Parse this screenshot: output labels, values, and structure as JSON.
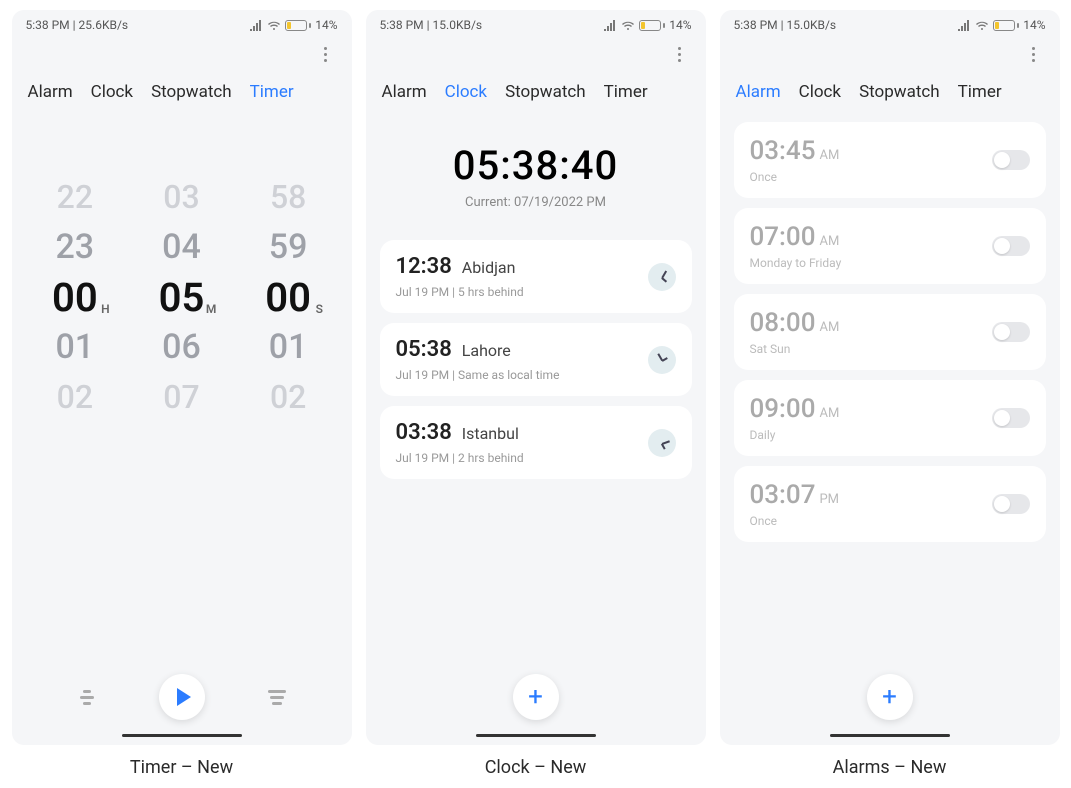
{
  "status": {
    "left1": "5:38 PM | 25.6KB/s",
    "left2": "5:38 PM | 15.0KB/s",
    "left3": "5:38 PM | 15.0KB/s",
    "battery": "14%"
  },
  "tabs": {
    "alarm": "Alarm",
    "clock": "Clock",
    "stopwatch": "Stopwatch",
    "timer": "Timer"
  },
  "timer": {
    "units": {
      "h": "H",
      "m": "M",
      "s": "S"
    },
    "cols": [
      [
        "22",
        "23",
        "00",
        "01",
        "02"
      ],
      [
        "03",
        "04",
        "05",
        "06",
        "07"
      ],
      [
        "58",
        "59",
        "00",
        "01",
        "02"
      ]
    ]
  },
  "clock": {
    "big": "05:38:40",
    "sub": "Current: 07/19/2022 PM",
    "cities": [
      {
        "time": "12:38",
        "name": "Abidjan",
        "sub": "Jul 19 PM  |  5 hrs behind"
      },
      {
        "time": "05:38",
        "name": "Lahore",
        "sub": "Jul 19 PM  |  Same as local time"
      },
      {
        "time": "03:38",
        "name": "Istanbul",
        "sub": "Jul 19 PM  |  2 hrs behind"
      }
    ]
  },
  "alarms": [
    {
      "time": "03:45",
      "ampm": "AM",
      "rep": "Once"
    },
    {
      "time": "07:00",
      "ampm": "AM",
      "rep": "Monday to Friday"
    },
    {
      "time": "08:00",
      "ampm": "AM",
      "rep": "Sat Sun"
    },
    {
      "time": "09:00",
      "ampm": "AM",
      "rep": "Daily"
    },
    {
      "time": "03:07",
      "ampm": "PM",
      "rep": "Once"
    }
  ],
  "captions": {
    "timer": "Timer – New",
    "clock": "Clock – New",
    "alarms": "Alarms – New"
  },
  "icons": {
    "plus": "+"
  }
}
